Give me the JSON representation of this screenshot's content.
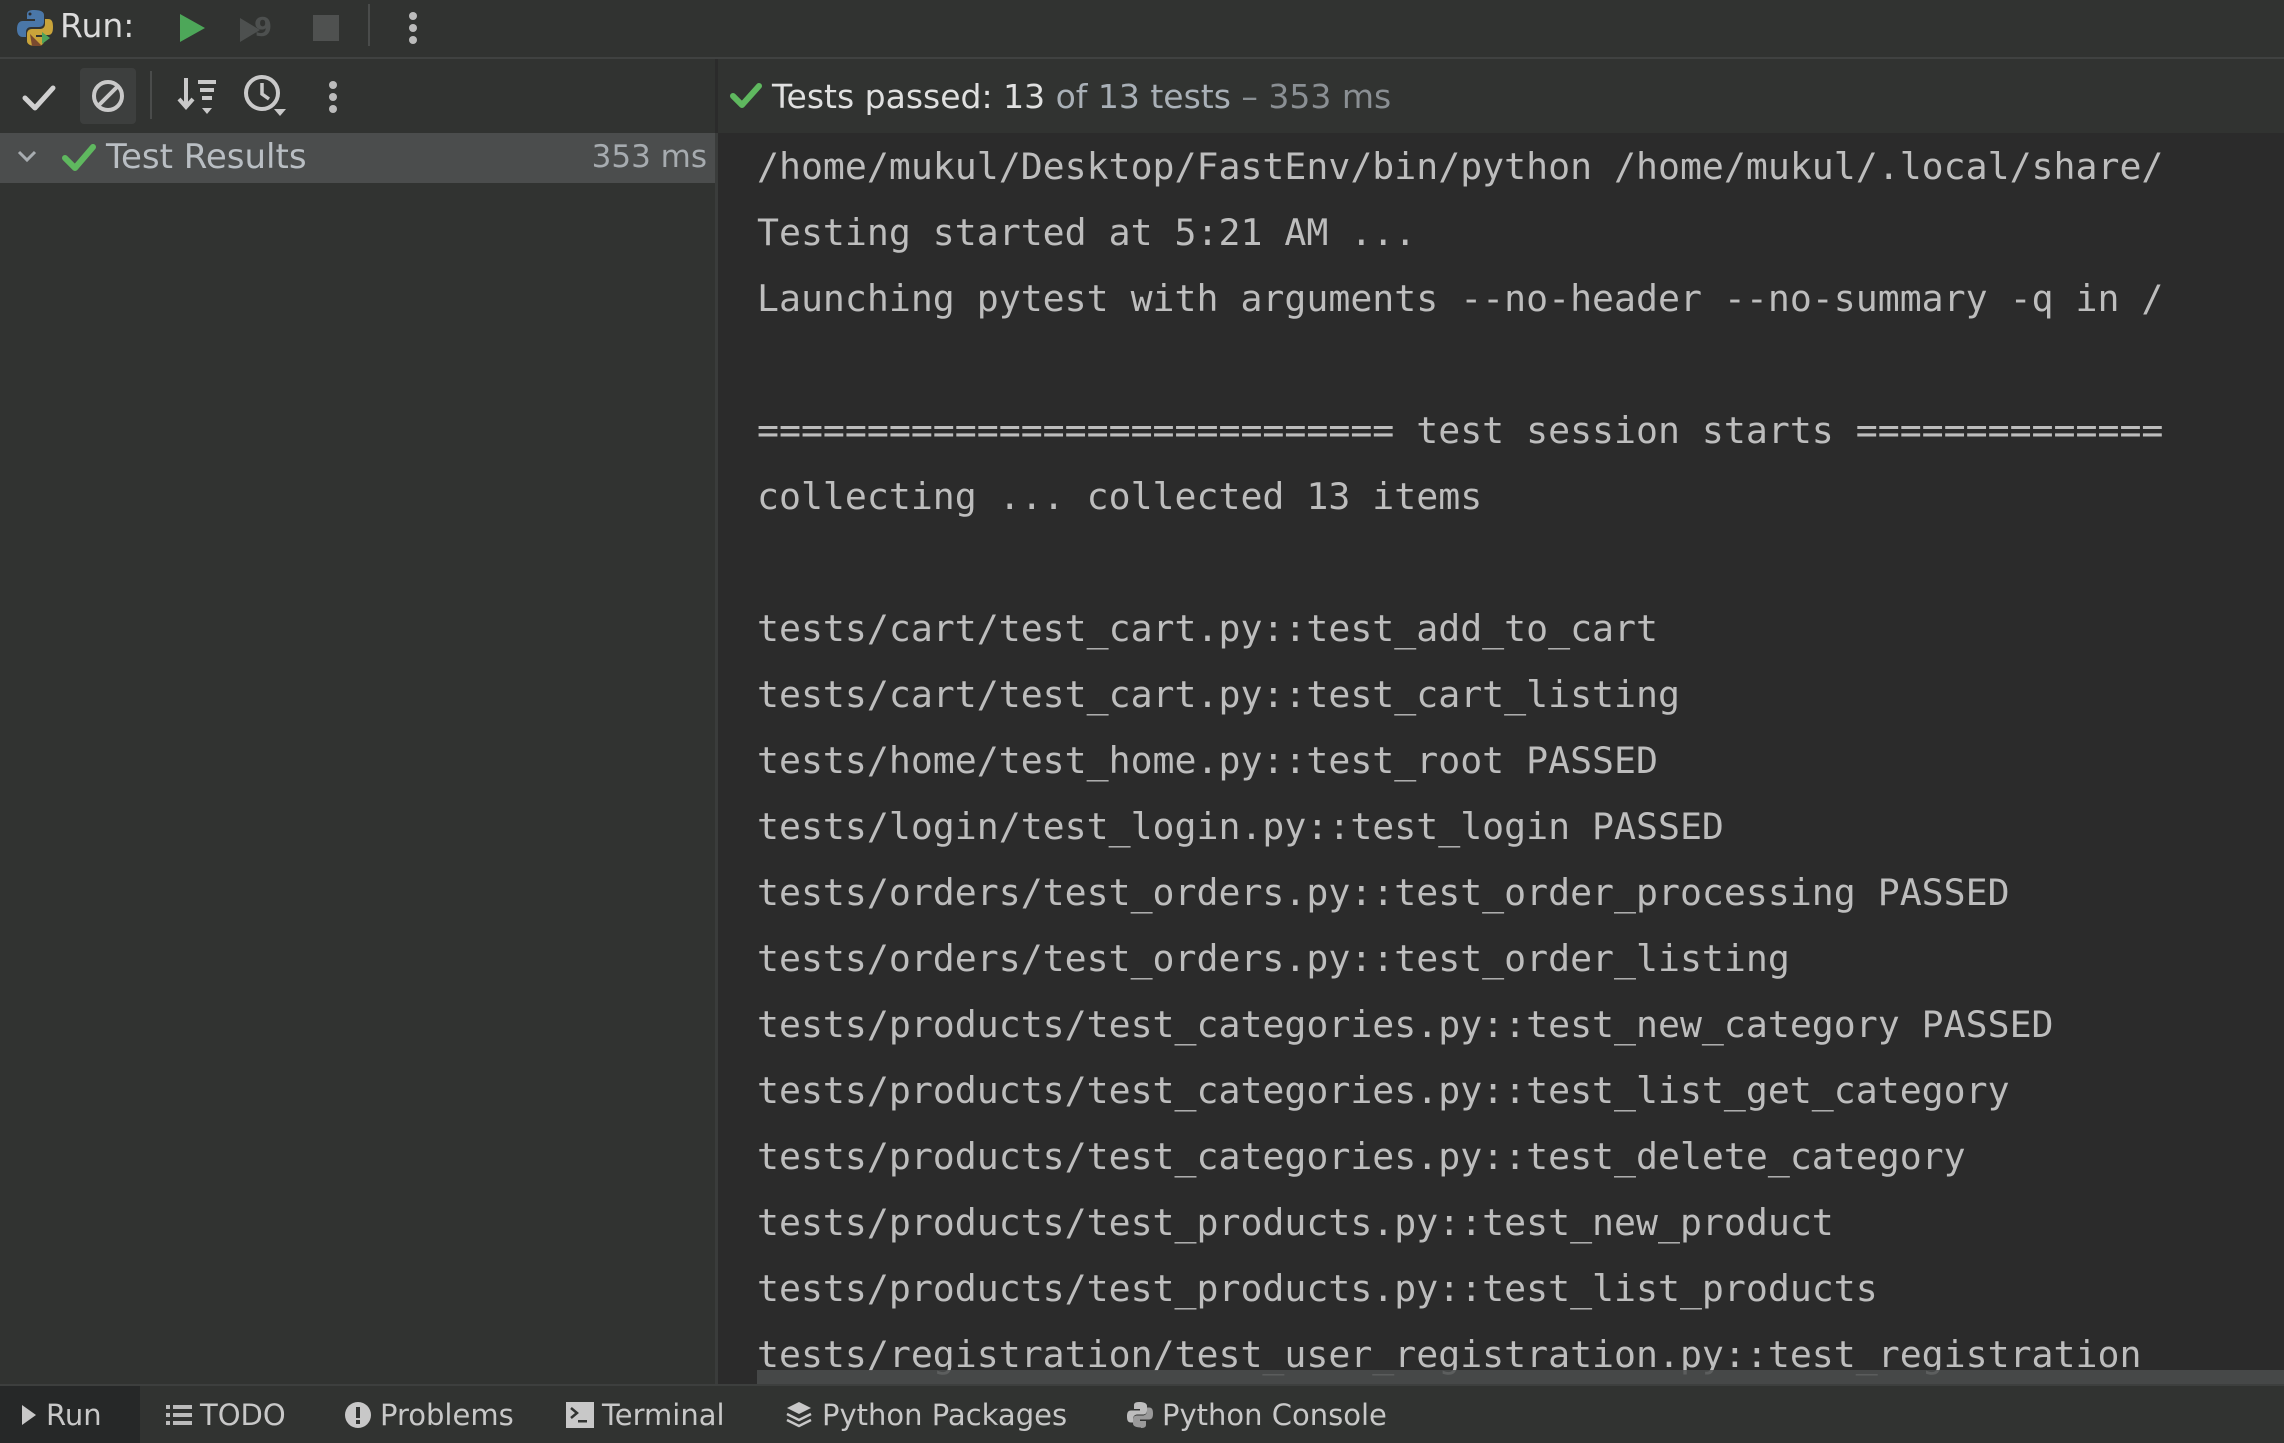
{
  "run_toolbar": {
    "title": "Run:",
    "icons": [
      "python-icon",
      "run-icon",
      "rerun-failed-icon",
      "stop-icon",
      "more-options-icon"
    ],
    "rerun_badge": "9"
  },
  "test_toolbar": {
    "icons": [
      "show-passed-icon",
      "show-ignored-icon",
      "sort-icon",
      "sort-by-duration-icon",
      "more-options-icon"
    ]
  },
  "status": {
    "prefix": "Tests passed: ",
    "passed": "13",
    "of_text": " of 13 tests",
    "separator": " – ",
    "duration": "353 ms",
    "color_ok": "#5fb85f"
  },
  "tree": {
    "root_label": "Test Results",
    "root_time": "353 ms",
    "expanded": true
  },
  "console": {
    "lines": [
      "/home/mukul/Desktop/FastEnv/bin/python /home/mukul/.local/share/",
      "Testing started at 5:21 AM ...",
      "Launching pytest with arguments --no-header --no-summary -q in /",
      "",
      "============================= test session starts ==============",
      "collecting ... collected 13 items",
      "",
      "tests/cart/test_cart.py::test_add_to_cart",
      "tests/cart/test_cart.py::test_cart_listing",
      "tests/home/test_home.py::test_root PASSED",
      "tests/login/test_login.py::test_login PASSED",
      "tests/orders/test_orders.py::test_order_processing PASSED",
      "tests/orders/test_orders.py::test_order_listing",
      "tests/products/test_categories.py::test_new_category PASSED",
      "tests/products/test_categories.py::test_list_get_category",
      "tests/products/test_categories.py::test_delete_category",
      "tests/products/test_products.py::test_new_product",
      "tests/products/test_products.py::test_list_products",
      "tests/registration/test_user_registration.py::test_registration"
    ]
  },
  "bottom_tabs": [
    {
      "label": "Run",
      "icon": "run-icon",
      "active": true
    },
    {
      "label": "TODO",
      "icon": "list-icon",
      "active": false
    },
    {
      "label": "Problems",
      "icon": "problems-icon",
      "active": false
    },
    {
      "label": "Terminal",
      "icon": "terminal-icon",
      "active": false
    },
    {
      "label": "Python Packages",
      "icon": "packages-icon",
      "active": false
    },
    {
      "label": "Python Console",
      "icon": "python-console-icon",
      "active": false
    }
  ]
}
